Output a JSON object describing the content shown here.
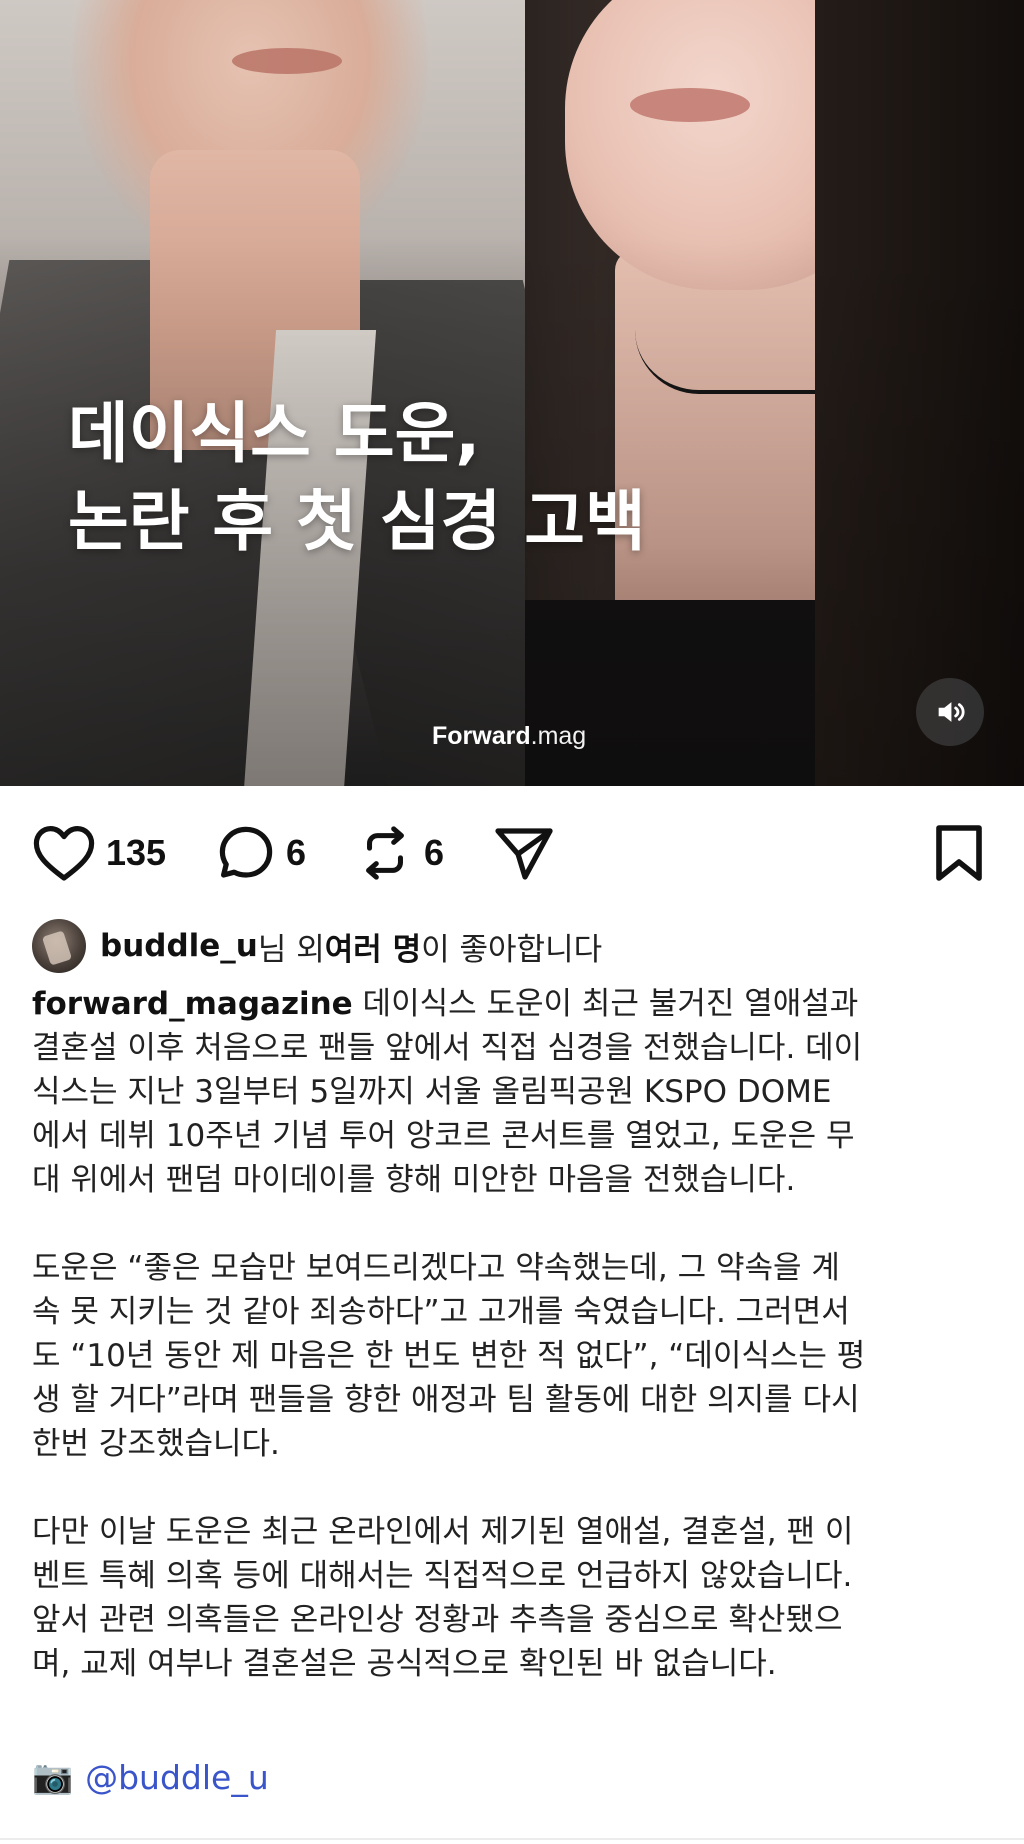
{
  "hero": {
    "title_line1": "데이식스 도운,",
    "title_line2": "논란 후 첫 심경 고백",
    "brand_bold": "Forward",
    "brand_suffix": ".mag"
  },
  "actions": {
    "likes": "135",
    "comments": "6",
    "reposts": "6"
  },
  "liked_by": {
    "user": "buddle_u",
    "mid": "님 외 ",
    "others": "여러 명",
    "end": "이 좋아합니다"
  },
  "caption": {
    "author": "forward_magazine",
    "p1_first": " 데이식스 도운이 최근 불거진 열애설과",
    "p1_lines": [
      "결혼설 이후 처음으로 팬들 앞에서 직접 심경을 전했습니다. 데이",
      "식스는 지난 3일부터 5일까지 서울 올림픽공원 KSPO DOME",
      "에서 데뷔 10주년 기념 투어 앙코르 콘서트를 열었고, 도운은 무",
      "대 위에서 팬덤 마이데이를 향해 미안한 마음을 전했습니다."
    ],
    "p2_lines": [
      "도운은 “좋은 모습만 보여드리겠다고 약속했는데, 그 약속을 계",
      "속 못 지키는 것 같아 죄송하다”고 고개를 숙였습니다. 그러면서",
      "도 “10년 동안 제 마음은 한 번도 변한 적 없다”, “데이식스는 평",
      "생 할 거다”라며 팬들을 향한 애정과 팀 활동에 대한 의지를 다시",
      "한번 강조했습니다."
    ],
    "p3_lines": [
      "다만 이날 도운은 최근 온라인에서 제기된 열애설, 결혼설, 팬 이",
      "벤트 특혜 의혹 등에 대해서는 직접적으로 언급하지 않았습니다.",
      "앞서 관련 의혹들은 온라인상 정황과 추측을 중심으로 확산됐으",
      "며, 교제 여부나 결혼설은 공식적으로 확인된 바 없습니다."
    ],
    "credit_icon": "📷",
    "credit_mention": "@buddle_u"
  },
  "icons": {
    "like": "heart-icon",
    "comment": "speech-bubble-icon",
    "repost": "repost-icon",
    "share": "paper-plane-icon",
    "save": "bookmark-icon",
    "sound": "speaker-icon"
  },
  "colors": {
    "mention": "#3a55c9",
    "text": "#222222"
  }
}
